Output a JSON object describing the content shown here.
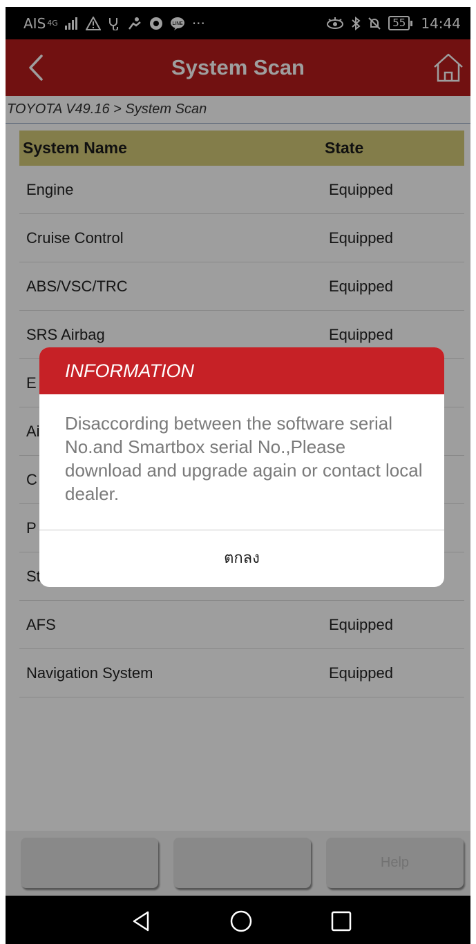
{
  "status_bar": {
    "carrier": "AIS",
    "network": "4G",
    "battery": "55",
    "time": "14:44",
    "icons": [
      "signal-icon",
      "warning-icon",
      "stethoscope-icon",
      "fitness-icon",
      "chrome-icon",
      "line-icon",
      "more-icon",
      "eye-icon",
      "bluetooth-icon",
      "bell-off-icon",
      "battery-icon"
    ]
  },
  "header": {
    "title": "System Scan",
    "back_icon": "chevron-left-icon",
    "home_icon": "home-icon",
    "color": "#b71c1c"
  },
  "breadcrumb": "TOYOTA V49.16 > System Scan",
  "table": {
    "header_color": "#d3ca78",
    "columns": [
      "System Name",
      "State"
    ],
    "rows": [
      {
        "name": "Engine",
        "state": "Equipped"
      },
      {
        "name": "Cruise Control",
        "state": "Equipped"
      },
      {
        "name": "ABS/VSC/TRC",
        "state": "Equipped"
      },
      {
        "name": "SRS Airbag",
        "state": "Equipped"
      },
      {
        "name": "E",
        "state": ""
      },
      {
        "name": "Ai",
        "state": ""
      },
      {
        "name": "C",
        "state": ""
      },
      {
        "name": "P",
        "state": ""
      },
      {
        "name": "St",
        "state": ""
      },
      {
        "name": "AFS",
        "state": "Equipped"
      },
      {
        "name": "Navigation System",
        "state": "Equipped"
      }
    ]
  },
  "footer": {
    "buttons": [
      "",
      "",
      "Help"
    ]
  },
  "nav": {
    "icons": [
      "back-triangle-icon",
      "home-circle-icon",
      "recents-square-icon"
    ]
  },
  "dialog": {
    "title": "INFORMATION",
    "message": "Disaccording between the software serial No.and Smartbox serial No.,Please download and upgrade again or contact local dealer.",
    "ok_label": "ตกลง",
    "accent": "#c62126"
  }
}
